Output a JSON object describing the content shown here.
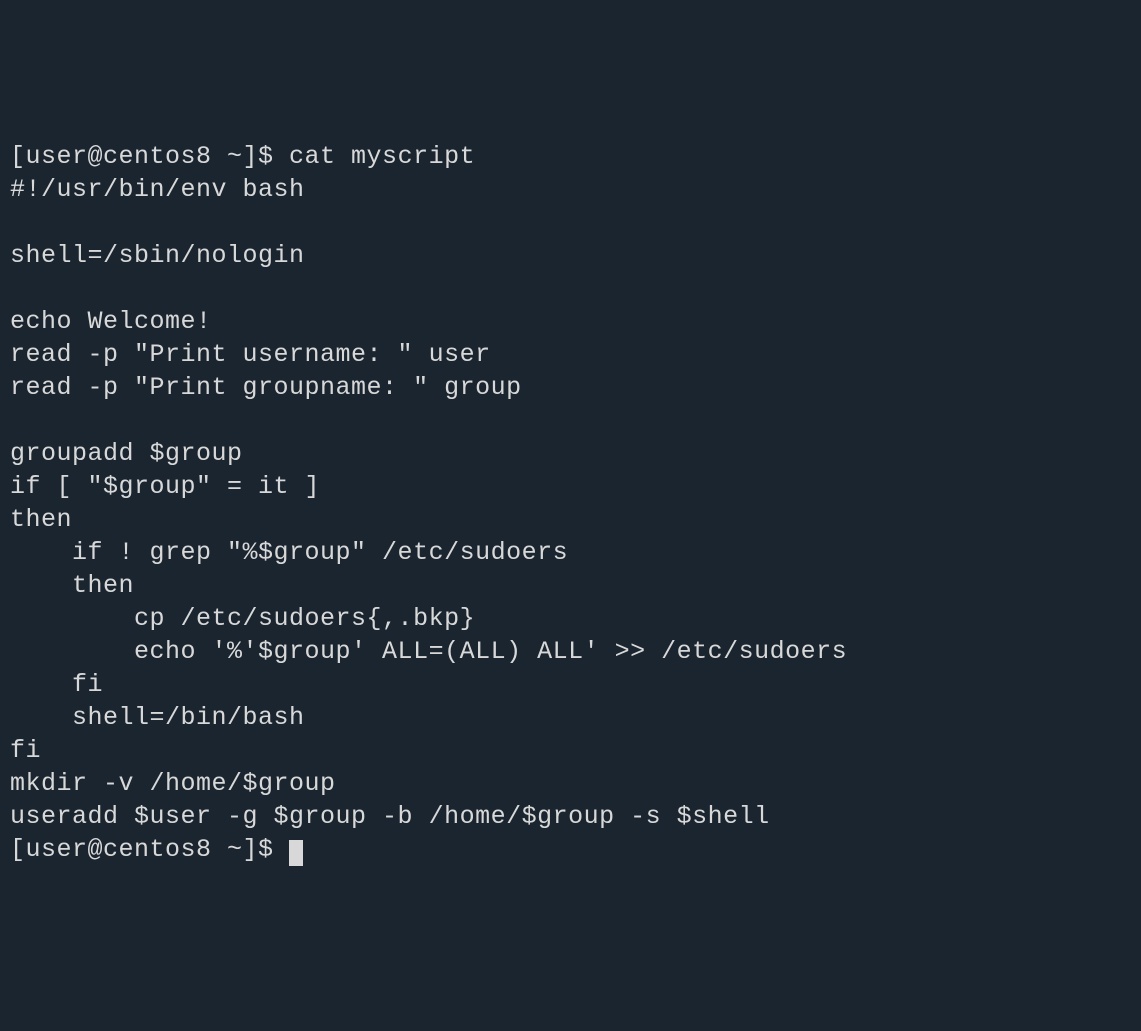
{
  "terminal": {
    "prompt1": "[user@centos8 ~]$ ",
    "command1": "cat myscript",
    "output": [
      "#!/usr/bin/env bash",
      "",
      "shell=/sbin/nologin",
      "",
      "echo Welcome!",
      "read -p \"Print username: \" user",
      "read -p \"Print groupname: \" group",
      "",
      "groupadd $group",
      "if [ \"$group\" = it ]",
      "then",
      "    if ! grep \"%$group\" /etc/sudoers",
      "    then",
      "        cp /etc/sudoers{,.bkp}",
      "        echo '%'$group' ALL=(ALL) ALL' >> /etc/sudoers",
      "    fi",
      "    shell=/bin/bash",
      "fi",
      "mkdir -v /home/$group",
      "useradd $user -g $group -b /home/$group -s $shell"
    ],
    "prompt2": "[user@centos8 ~]$ "
  }
}
